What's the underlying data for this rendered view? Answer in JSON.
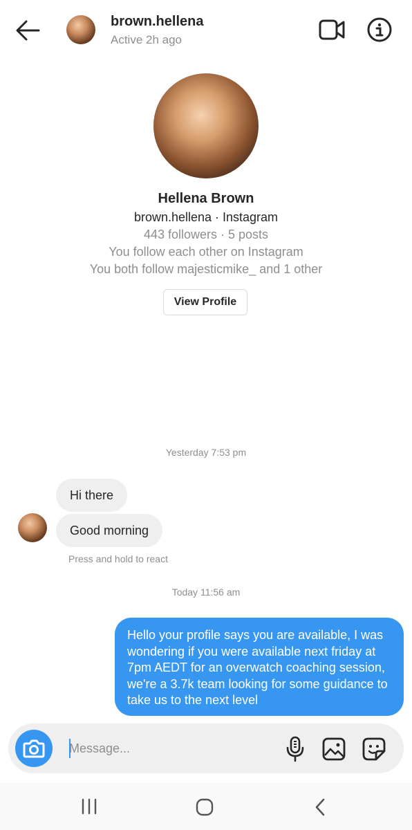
{
  "header": {
    "username": "brown.hellena",
    "status": "Active 2h ago",
    "icons": [
      "back-arrow-icon",
      "video-camera-icon",
      "info-icon"
    ]
  },
  "profile": {
    "display_name": "Hellena Brown",
    "handle_line": "brown.hellena · Instagram",
    "stats": "443 followers · 5 posts",
    "mutual_line": "You follow each other on Instagram",
    "followers_line": "You both follow majesticmike_ and 1 other",
    "view_profile_label": "View Profile"
  },
  "chat": {
    "timestamp_1": "Yesterday 7:53 pm",
    "incoming": [
      {
        "text": "Hi there"
      },
      {
        "text": "Good morning"
      }
    ],
    "react_hint": "Press and hold to react",
    "timestamp_2": "Today 11:56 am",
    "outgoing": [
      {
        "text": "Hello your profile says you are available, I was wondering if you were available next friday at 7pm AEDT for an overwatch coaching session, we're a 3.7k team looking for some guidance to take us to the next level"
      }
    ]
  },
  "composer": {
    "placeholder": "Message...",
    "icons": [
      "camera-icon",
      "microphone-icon",
      "gallery-icon",
      "sticker-icon"
    ]
  },
  "colors": {
    "accent": "#3797f0",
    "incoming_bubble": "#efefef",
    "secondary_text": "#8e8e8e"
  }
}
